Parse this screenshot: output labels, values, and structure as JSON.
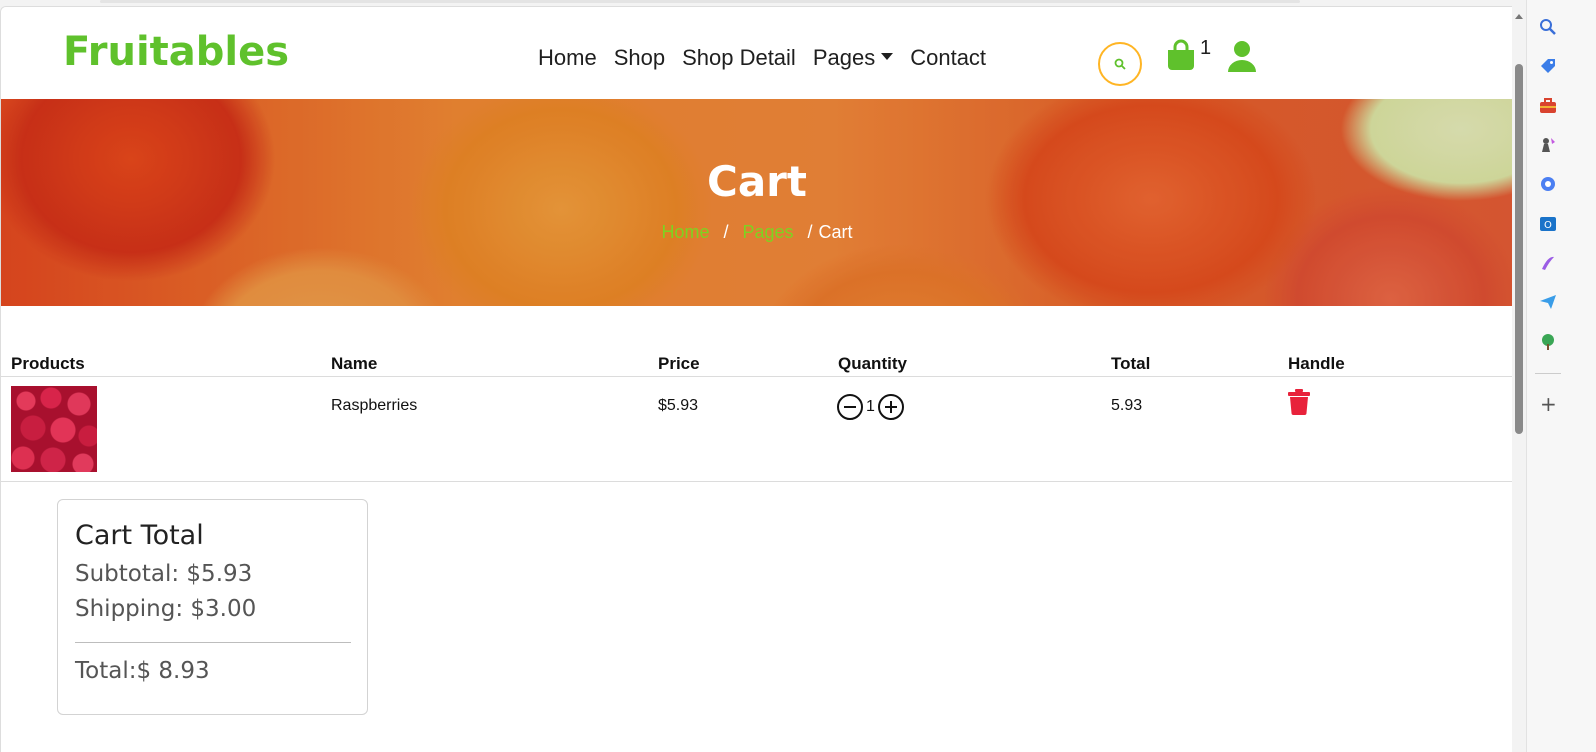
{
  "brand": {
    "name": "Fruitables",
    "color": "#5fc12c"
  },
  "nav": {
    "items": [
      {
        "label": "Home"
      },
      {
        "label": "Shop"
      },
      {
        "label": "Shop Detail"
      },
      {
        "label": "Pages",
        "dropdown": true
      },
      {
        "label": "Contact"
      }
    ]
  },
  "header_icons": {
    "search": "search-icon",
    "cart": "shopping-bag-icon",
    "cart_count": "1",
    "user": "user-icon"
  },
  "hero": {
    "title": "Cart",
    "breadcrumb": [
      {
        "label": "Home",
        "link": true
      },
      {
        "label": "Pages",
        "link": true
      },
      {
        "label": "Cart",
        "link": false
      }
    ],
    "separator": "/"
  },
  "table": {
    "headers": [
      "Products",
      "Name",
      "Price",
      "Quantity",
      "Total",
      "Handle"
    ],
    "rows": [
      {
        "image": "raspberries-image",
        "name": "Raspberries",
        "price": "$5.93",
        "quantity": "1",
        "total": "5.93",
        "handle": "trash-icon"
      }
    ]
  },
  "cart_total": {
    "title": "Cart Total",
    "subtotal": "Subtotal: $5.93",
    "shipping": "Shipping: $3.00",
    "total": "Total:$ 8.93"
  },
  "colors": {
    "accent_green": "#5fc12c",
    "link_green": "#7ed321",
    "search_border": "#ffb524",
    "trash_red": "#e8223b"
  }
}
